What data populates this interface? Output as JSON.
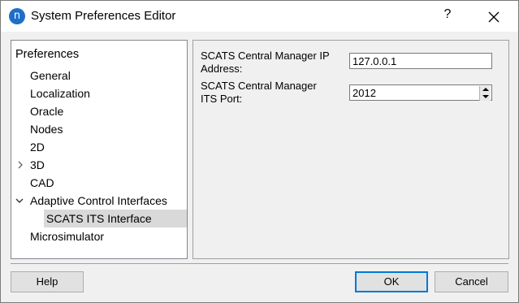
{
  "window": {
    "title": "System Preferences Editor",
    "app_icon_glyph": "n",
    "help_glyph": "?",
    "accent_color": "#0078d7"
  },
  "tree": {
    "header": "Preferences",
    "items": [
      {
        "label": "General"
      },
      {
        "label": "Localization"
      },
      {
        "label": "Oracle"
      },
      {
        "label": "Nodes"
      },
      {
        "label": "2D"
      },
      {
        "label": "3D",
        "expander": "collapsed"
      },
      {
        "label": "CAD"
      },
      {
        "label": "Adaptive Control Interfaces",
        "expander": "expanded"
      },
      {
        "label": "SCATS ITS Interface",
        "selected": true
      },
      {
        "label": "Microsimulator"
      }
    ]
  },
  "form": {
    "ip_label": "SCATS Central Manager IP Address:",
    "ip_value": "127.0.0.1",
    "port_label": "SCATS Central Manager ITS Port:",
    "port_value": "2012"
  },
  "buttons": {
    "help": "Help",
    "ok": "OK",
    "cancel": "Cancel"
  }
}
